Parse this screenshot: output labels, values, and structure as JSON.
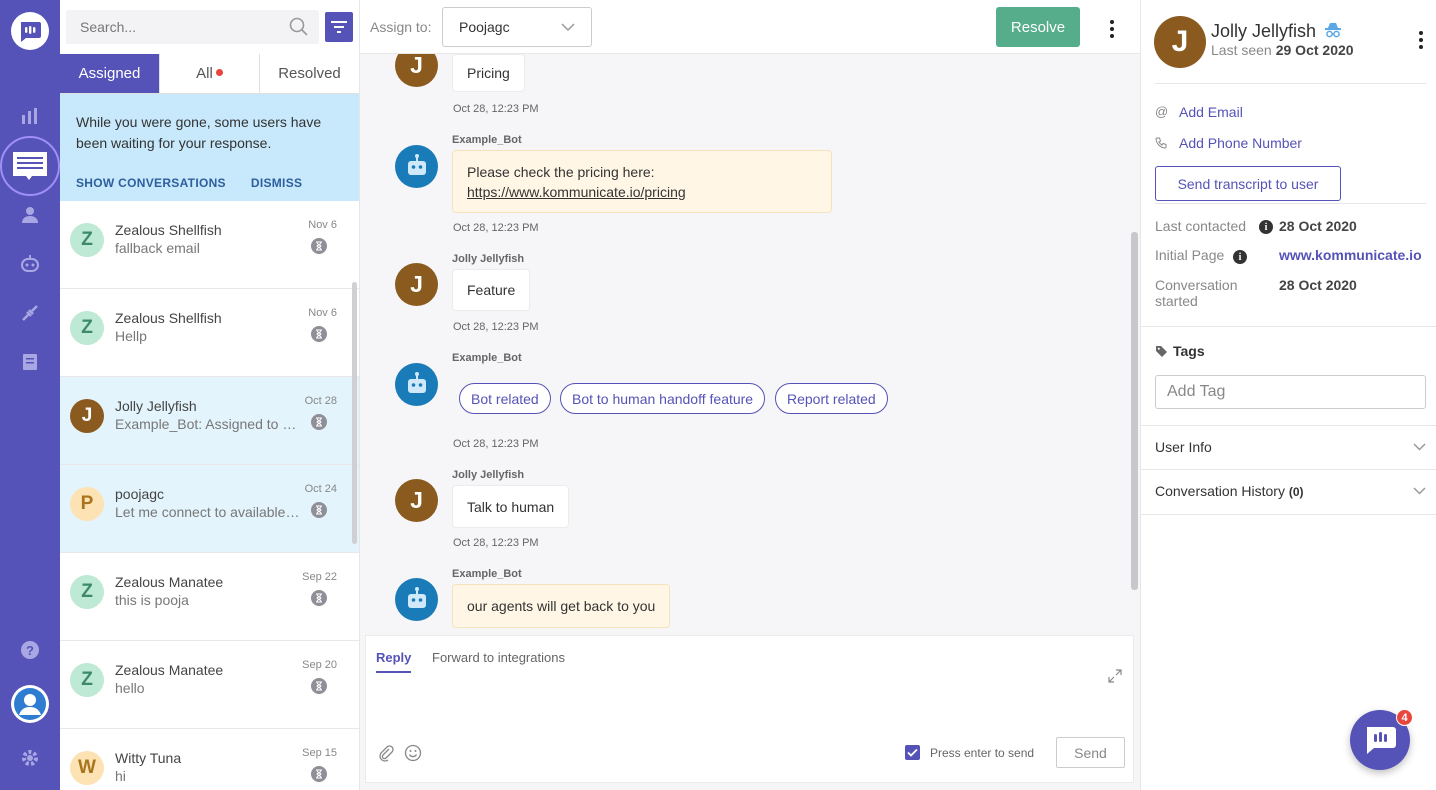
{
  "rail": {
    "icons": [
      "chat-logo-icon",
      "reports-icon",
      "conversations-icon",
      "users-icon",
      "bot-icon",
      "integrations-icon",
      "knowledge-base-icon",
      "help-icon",
      "profile-avatar-icon",
      "settings-icon"
    ]
  },
  "list": {
    "search_placeholder": "Search...",
    "tabs": [
      {
        "label": "Assigned",
        "active": true
      },
      {
        "label": "All",
        "has_dot": true
      },
      {
        "label": "Resolved"
      }
    ],
    "notice": {
      "text": "While you were gone, some users have been waiting for your response.",
      "show_label": "SHOW CONVERSATIONS",
      "dismiss_label": "DISMISS"
    },
    "conversations": [
      {
        "initial": "Z",
        "name": "Zealous Shellfish",
        "message": "fallback email",
        "date": "Nov 6",
        "avatar_bg": "#bde9d5",
        "avatar_fg": "#3d8a66"
      },
      {
        "initial": "Z",
        "name": "Zealous Shellfish",
        "message": "Hellp",
        "date": "Nov 6",
        "avatar_bg": "#bde9d5",
        "avatar_fg": "#3d8a66"
      },
      {
        "initial": "J",
        "name": "Jolly Jellyfish",
        "message": "Example_Bot: Assigned to poojagc",
        "date": "Oct 28",
        "avatar_bg": "#8b5a1f",
        "avatar_fg": "#ffffff",
        "selected": true
      },
      {
        "initial": "P",
        "name": "poojagc",
        "message": "Let me connect to available agents",
        "date": "Oct 24",
        "avatar_bg": "#fde2b3",
        "avatar_fg": "#a8741e",
        "selected": true
      },
      {
        "initial": "Z",
        "name": "Zealous Manatee",
        "message": "this is pooja",
        "date": "Sep 22",
        "avatar_bg": "#bde9d5",
        "avatar_fg": "#3d8a66"
      },
      {
        "initial": "Z",
        "name": "Zealous Manatee",
        "message": "hello",
        "date": "Sep 20",
        "avatar_bg": "#bde9d5",
        "avatar_fg": "#3d8a66"
      },
      {
        "initial": "W",
        "name": "Witty Tuna",
        "message": "hi",
        "date": "Sep 15",
        "avatar_bg": "#fde2b3",
        "avatar_fg": "#a8741e"
      }
    ]
  },
  "topbar": {
    "assign_label": "Assign to:",
    "assignee": "Poojagc",
    "resolve_label": "Resolve"
  },
  "chat": {
    "m1": {
      "avatar": "J",
      "text": "Pricing",
      "time": "Oct 28, 12:23 PM"
    },
    "m2": {
      "sender": "Example_Bot",
      "text1": "Please check the pricing here:",
      "link": "https://www.kommunicate.io/pricing",
      "time": "Oct 28, 12:23 PM"
    },
    "m3": {
      "sender": "Jolly Jellyfish",
      "avatar": "J",
      "text": "Feature",
      "time": "Oct 28, 12:23 PM"
    },
    "m4": {
      "sender": "Example_Bot",
      "quick_replies": [
        "Bot related",
        "Bot to human handoff feature",
        "Report related"
      ],
      "time": "Oct 28, 12:23 PM"
    },
    "m5": {
      "sender": "Jolly Jellyfish",
      "avatar": "J",
      "text": "Talk to human",
      "time": "Oct 28, 12:23 PM"
    },
    "m6": {
      "sender": "Example_Bot",
      "text": "our agents will get back to you"
    }
  },
  "composer": {
    "reply_tab": "Reply",
    "forward_tab": "Forward to integrations",
    "enter_label": "Press enter to send",
    "enter_checked": true,
    "send_label": "Send"
  },
  "profile": {
    "initial": "J",
    "name": "Jolly Jellyfish",
    "last_seen_label": "Last seen",
    "last_seen_value": "29 Oct 2020",
    "add_email": "Add Email",
    "add_phone": "Add Phone Number",
    "transcript_label": "Send transcript to user",
    "last_contacted_label": "Last contacted",
    "last_contacted_value": "28 Oct 2020",
    "initial_page_label": "Initial Page",
    "initial_page_value": "www.kommunicate.io",
    "started_label": "Conversation started",
    "started_value": "28 Oct 2020",
    "tags_label": "Tags",
    "tag_placeholder": "Add Tag",
    "user_info_label": "User Info",
    "history_label": "Conversation History",
    "history_count": "(0)"
  },
  "widget": {
    "badge": "4"
  },
  "colors": {
    "brand": "#5553b7",
    "resolve": "#55ad8b",
    "notice": "#c8e9fb",
    "alert": "#e8453c"
  }
}
